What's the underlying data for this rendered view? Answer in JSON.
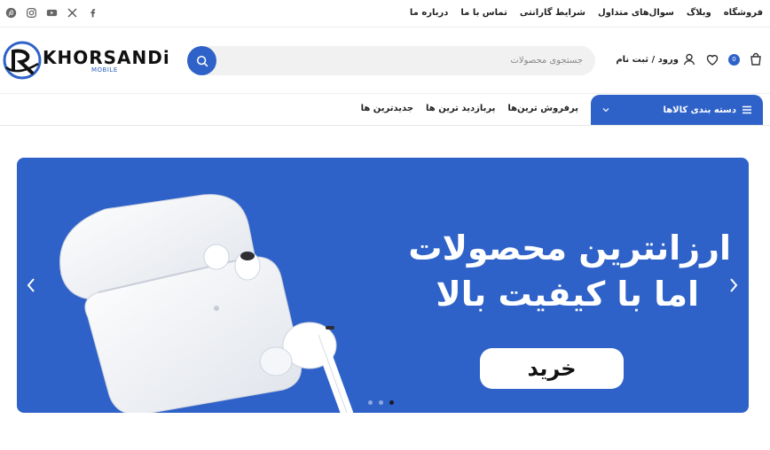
{
  "topbar": {
    "social": [
      "pinterest-icon",
      "instagram-icon",
      "youtube-icon",
      "x-icon",
      "facebook-icon"
    ],
    "nav": [
      "فروشگاه",
      "وبلاگ",
      "سوال‌های متداول",
      "شرایط گارانتی",
      "تماس با ما",
      "درباره ما"
    ]
  },
  "header": {
    "logo_text": "KHORSANDi",
    "logo_sub": "MOBILE",
    "search_placeholder": "جستجوی محصولات",
    "cart_count": "0",
    "login_label": "ورود / ثبت نام"
  },
  "navbar": {
    "categories_label": "دسته بندی کالاها",
    "menu": [
      "پرفروش ترین‌ها",
      "پربازدید ترین ها",
      "جدیدترین ها"
    ]
  },
  "hero": {
    "line1": "ارزانترین محصولات",
    "line2": "اما با کیفیت بالا",
    "cta": "خرید",
    "slide_count": 3,
    "active_slide": 3
  },
  "colors": {
    "brand": "#2f62c8",
    "text": "#222222"
  }
}
